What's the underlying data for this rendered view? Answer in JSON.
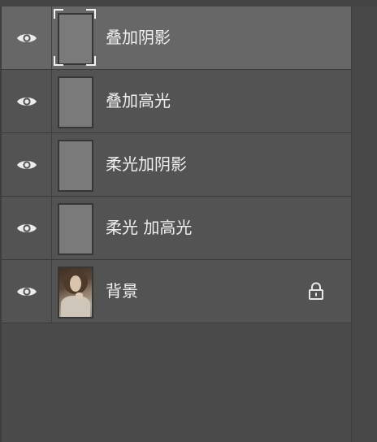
{
  "layers_panel": {
    "layers": [
      {
        "name": "叠加阴影",
        "visible": true,
        "selected": true,
        "thumbnail": "gray-fill",
        "locked": false
      },
      {
        "name": "叠加高光",
        "visible": true,
        "selected": false,
        "thumbnail": "gray-fill",
        "locked": false
      },
      {
        "name": "柔光加阴影",
        "visible": true,
        "selected": false,
        "thumbnail": "gray-fill",
        "locked": false
      },
      {
        "name": "柔光 加高光",
        "visible": true,
        "selected": false,
        "thumbnail": "gray-fill",
        "locked": false
      },
      {
        "name": "背景",
        "visible": true,
        "selected": false,
        "thumbnail": "portrait-photo",
        "locked": true
      }
    ]
  },
  "icons": {
    "visibility": "eye-icon",
    "lock": "lock-icon"
  },
  "colors": {
    "panel_bg": "#535353",
    "selected_row": "#676767",
    "text": "#f0f0f0"
  }
}
